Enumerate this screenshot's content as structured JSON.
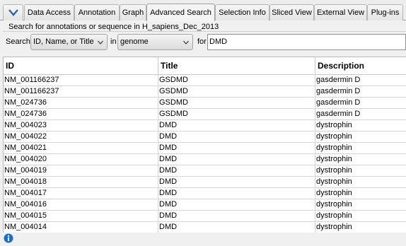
{
  "tabs": [
    {
      "label": "Data Access"
    },
    {
      "label": "Annotation"
    },
    {
      "label": "Graph"
    },
    {
      "label": "Advanced Search"
    },
    {
      "label": "Selection Info"
    },
    {
      "label": "Sliced View"
    },
    {
      "label": "External View"
    },
    {
      "label": "Plug-ins"
    }
  ],
  "active_tab": "Advanced Search",
  "search": {
    "panel_title": "Search for annotations or sequence in H_sapiens_Dec_2013",
    "search_label": "Search",
    "search_type": "ID, Name, or Title",
    "in_label": "in",
    "scope": "genome",
    "for_label": "for",
    "query": "DMD"
  },
  "table": {
    "columns": [
      "ID",
      "Title",
      "Description"
    ],
    "rows": [
      [
        "NM_001166237",
        "GSDMD",
        "gasdermin D"
      ],
      [
        "NM_001166237",
        "GSDMD",
        "gasdermin D"
      ],
      [
        "NM_024736",
        "GSDMD",
        "gasdermin D"
      ],
      [
        "NM_024736",
        "GSDMD",
        "gasdermin D"
      ],
      [
        "NM_004023",
        "DMD",
        "dystrophin"
      ],
      [
        "NM_004022",
        "DMD",
        "dystrophin"
      ],
      [
        "NM_004021",
        "DMD",
        "dystrophin"
      ],
      [
        "NM_004020",
        "DMD",
        "dystrophin"
      ],
      [
        "NM_004019",
        "DMD",
        "dystrophin"
      ],
      [
        "NM_004018",
        "DMD",
        "dystrophin"
      ],
      [
        "NM_004017",
        "DMD",
        "dystrophin"
      ],
      [
        "NM_004016",
        "DMD",
        "dystrophin"
      ],
      [
        "NM_004015",
        "DMD",
        "dystrophin"
      ],
      [
        "NM_004014",
        "DMD",
        "dystrophin"
      ]
    ]
  },
  "icons": {
    "collapse": "chevron-down-icon",
    "combo_arrow": "chevron-down-icon",
    "status": "info-icon"
  },
  "colors": {
    "info_icon": "#1a6fc9",
    "chevron": "#2a64b4"
  }
}
